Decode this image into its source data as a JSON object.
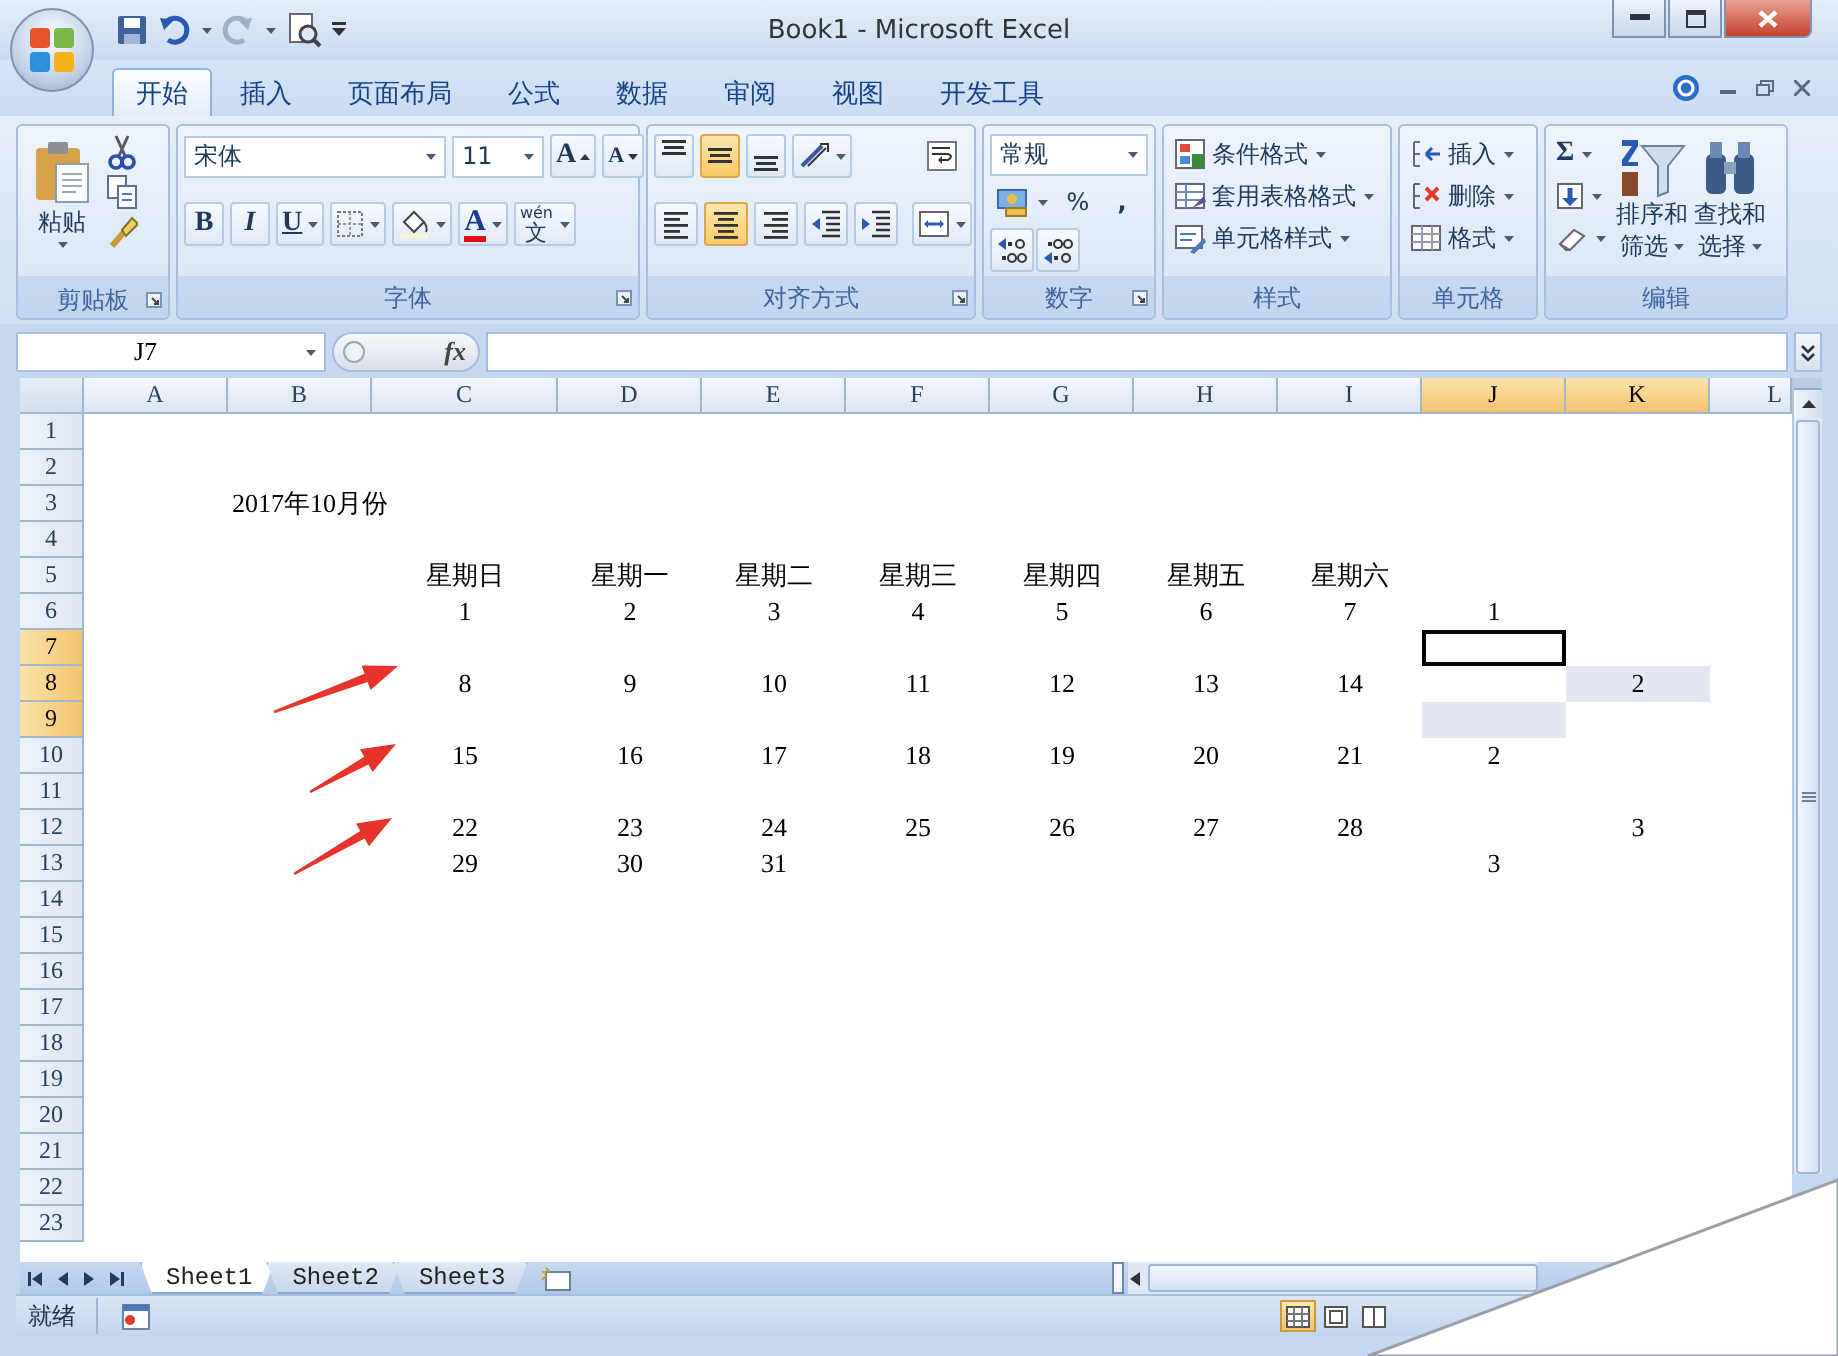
{
  "window": {
    "title": "Book1 - Microsoft Excel"
  },
  "tabs": [
    {
      "label": "开始",
      "selected": true
    },
    {
      "label": "插入",
      "selected": false
    },
    {
      "label": "页面布局",
      "selected": false
    },
    {
      "label": "公式",
      "selected": false
    },
    {
      "label": "数据",
      "selected": false
    },
    {
      "label": "审阅",
      "selected": false
    },
    {
      "label": "视图",
      "selected": false
    },
    {
      "label": "开发工具",
      "selected": false
    }
  ],
  "ribbon": {
    "groups": [
      {
        "kind": "clipboard",
        "label": "剪贴板",
        "paste": "粘贴"
      },
      {
        "kind": "font",
        "label": "字体",
        "font_name": "宋体",
        "font_size": "11",
        "grow": "A",
        "shrink": "A",
        "bold": "B",
        "italic": "I",
        "underline": "U",
        "font_color": "A",
        "phonetic": "wén",
        "phonetic_char": "文"
      },
      {
        "kind": "alignment",
        "label": "对齐方式",
        "vertical": [
          {
            "selected": false
          },
          {
            "selected": true
          },
          {
            "selected": false
          }
        ],
        "horizontal": [
          {
            "selected": false
          },
          {
            "selected": true
          },
          {
            "selected": false
          }
        ]
      },
      {
        "kind": "number",
        "label": "数字",
        "format": "常规",
        "percent": "%",
        "comma": ","
      },
      {
        "kind": "styles",
        "label": "样式",
        "buttons": [
          "条件格式",
          "套用表格格式",
          "单元格样式"
        ]
      },
      {
        "kind": "cells",
        "label": "单元格",
        "buttons": [
          "插入",
          "删除",
          "格式"
        ]
      },
      {
        "kind": "editing",
        "label": "编辑",
        "sum": "Σ",
        "buttons": [
          {
            "lines": [
              "排序和",
              "筛选"
            ]
          },
          {
            "lines": [
              "查找和",
              "选择"
            ]
          }
        ]
      }
    ]
  },
  "formula_bar": {
    "name_box": "J7",
    "function_label": "fx"
  },
  "sheet": {
    "columns": [
      {
        "label": "A",
        "selected": false
      },
      {
        "label": "B",
        "selected": false
      },
      {
        "label": "C",
        "selected": false
      },
      {
        "label": "D",
        "selected": false
      },
      {
        "label": "E",
        "selected": false
      },
      {
        "label": "F",
        "selected": false
      },
      {
        "label": "G",
        "selected": false
      },
      {
        "label": "H",
        "selected": false
      },
      {
        "label": "I",
        "selected": false
      },
      {
        "label": "J",
        "selected": true
      },
      {
        "label": "K",
        "selected": true
      },
      {
        "label": "L",
        "selected": false
      }
    ],
    "rows": [
      {
        "label": "1",
        "selected": false
      },
      {
        "label": "2",
        "selected": false
      },
      {
        "label": "3",
        "selected": false,
        "cells": [
          null,
          {
            "text": "2017年10月份",
            "kind": "title",
            "shaded": false,
            "active": false
          }
        ]
      },
      {
        "label": "4",
        "selected": false
      },
      {
        "label": "5",
        "selected": false,
        "cells": [
          null,
          null,
          {
            "text": "星期日",
            "kind": "value",
            "shaded": false,
            "active": false
          },
          {
            "text": "星期一",
            "kind": "value",
            "shaded": false,
            "active": false
          },
          {
            "text": "星期二",
            "kind": "value",
            "shaded": false,
            "active": false
          },
          {
            "text": "星期三",
            "kind": "value",
            "shaded": false,
            "active": false
          },
          {
            "text": "星期四",
            "kind": "value",
            "shaded": false,
            "active": false
          },
          {
            "text": "星期五",
            "kind": "value",
            "shaded": false,
            "active": false
          },
          {
            "text": "星期六",
            "kind": "value",
            "shaded": false,
            "active": false
          }
        ]
      },
      {
        "label": "6",
        "selected": false,
        "cells": [
          null,
          null,
          {
            "text": "1",
            "kind": "value",
            "shaded": false,
            "active": false
          },
          {
            "text": "2",
            "kind": "value",
            "shaded": false,
            "active": false
          },
          {
            "text": "3",
            "kind": "value",
            "shaded": false,
            "active": false
          },
          {
            "text": "4",
            "kind": "value",
            "shaded": false,
            "active": false
          },
          {
            "text": "5",
            "kind": "value",
            "shaded": false,
            "active": false
          },
          {
            "text": "6",
            "kind": "value",
            "shaded": false,
            "active": false
          },
          {
            "text": "7",
            "kind": "value",
            "shaded": false,
            "active": false
          },
          {
            "text": "1",
            "kind": "value",
            "shaded": false,
            "active": false
          }
        ]
      },
      {
        "label": "7",
        "selected": true,
        "cells": [
          null,
          null,
          null,
          null,
          null,
          null,
          null,
          null,
          null,
          {
            "kind": "value",
            "shaded": false,
            "active": true
          }
        ]
      },
      {
        "label": "8",
        "selected": true,
        "cells": [
          null,
          null,
          {
            "text": "8",
            "kind": "value",
            "shaded": false,
            "active": false
          },
          {
            "text": "9",
            "kind": "value",
            "shaded": false,
            "active": false
          },
          {
            "text": "10",
            "kind": "value",
            "shaded": false,
            "active": false
          },
          {
            "text": "11",
            "kind": "value",
            "shaded": false,
            "active": false
          },
          {
            "text": "12",
            "kind": "value",
            "shaded": false,
            "active": false
          },
          {
            "text": "13",
            "kind": "value",
            "shaded": false,
            "active": false
          },
          {
            "text": "14",
            "kind": "value",
            "shaded": false,
            "active": false
          },
          null,
          {
            "text": "2",
            "kind": "value",
            "shaded": true,
            "active": false
          }
        ]
      },
      {
        "label": "9",
        "selected": true,
        "cells": [
          null,
          null,
          null,
          null,
          null,
          null,
          null,
          null,
          null,
          {
            "kind": "value",
            "shaded": true,
            "active": false
          }
        ]
      },
      {
        "label": "10",
        "selected": false,
        "cells": [
          null,
          null,
          {
            "text": "15",
            "kind": "value",
            "shaded": false,
            "active": false
          },
          {
            "text": "16",
            "kind": "value",
            "shaded": false,
            "active": false
          },
          {
            "text": "17",
            "kind": "value",
            "shaded": false,
            "active": false
          },
          {
            "text": "18",
            "kind": "value",
            "shaded": false,
            "active": false
          },
          {
            "text": "19",
            "kind": "value",
            "shaded": false,
            "active": false
          },
          {
            "text": "20",
            "kind": "value",
            "shaded": false,
            "active": false
          },
          {
            "text": "21",
            "kind": "value",
            "shaded": false,
            "active": false
          },
          {
            "text": "2",
            "kind": "value",
            "shaded": false,
            "active": false
          }
        ]
      },
      {
        "label": "11",
        "selected": false
      },
      {
        "label": "12",
        "selected": false,
        "cells": [
          null,
          null,
          {
            "text": "22",
            "kind": "value",
            "shaded": false,
            "active": false
          },
          {
            "text": "23",
            "kind": "value",
            "shaded": false,
            "active": false
          },
          {
            "text": "24",
            "kind": "value",
            "shaded": false,
            "active": false
          },
          {
            "text": "25",
            "kind": "value",
            "shaded": false,
            "active": false
          },
          {
            "text": "26",
            "kind": "value",
            "shaded": false,
            "active": false
          },
          {
            "text": "27",
            "kind": "value",
            "shaded": false,
            "active": false
          },
          {
            "text": "28",
            "kind": "value",
            "shaded": false,
            "active": false
          },
          null,
          {
            "text": "3",
            "kind": "value",
            "shaded": false,
            "active": false
          }
        ]
      },
      {
        "label": "13",
        "selected": false,
        "cells": [
          null,
          null,
          {
            "text": "29",
            "kind": "value",
            "shaded": false,
            "active": false
          },
          {
            "text": "30",
            "kind": "value",
            "shaded": false,
            "active": false
          },
          {
            "text": "31",
            "kind": "value",
            "shaded": false,
            "active": false
          },
          null,
          null,
          null,
          null,
          {
            "text": "3",
            "kind": "value",
            "shaded": false,
            "active": false
          }
        ]
      },
      {
        "label": "14",
        "selected": false
      },
      {
        "label": "15",
        "selected": false
      },
      {
        "label": "16",
        "selected": false
      },
      {
        "label": "17",
        "selected": false
      },
      {
        "label": "18",
        "selected": false
      },
      {
        "label": "19",
        "selected": false
      },
      {
        "label": "20",
        "selected": false
      },
      {
        "label": "21",
        "selected": false
      },
      {
        "label": "22",
        "selected": false
      },
      {
        "label": "23",
        "selected": false
      }
    ]
  },
  "sheet_tabs": [
    {
      "label": "Sheet1",
      "selected": true
    },
    {
      "label": "Sheet2",
      "selected": false
    },
    {
      "label": "Sheet3",
      "selected": false
    }
  ],
  "status_bar": {
    "text": "就绪"
  }
}
